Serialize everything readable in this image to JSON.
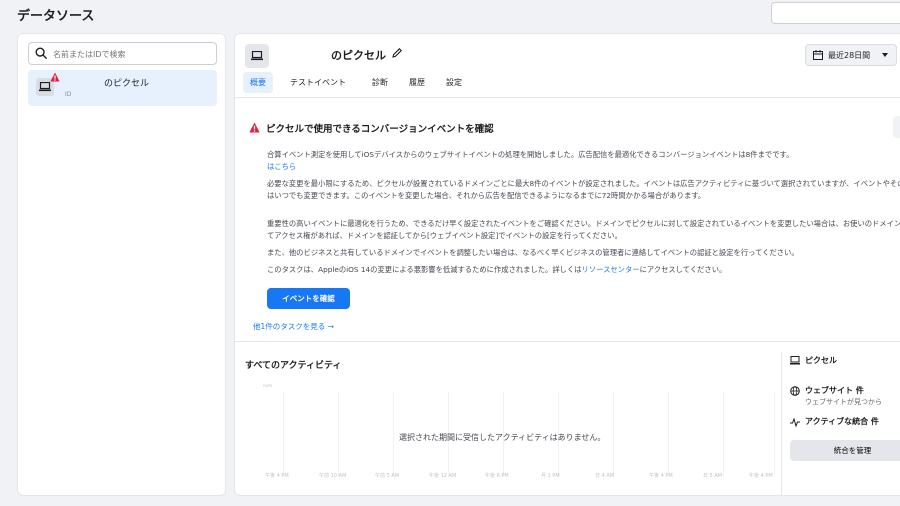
{
  "header": {
    "title": "データソース",
    "search_value": ""
  },
  "sidebar": {
    "search_placeholder": "名前またはIDで検索",
    "items": [
      {
        "name": "のピクセル",
        "id_label": "ID"
      }
    ]
  },
  "pixel": {
    "name": "のピクセル"
  },
  "date_range": {
    "label": "最近28日間"
  },
  "tabs": [
    {
      "label": "概要",
      "active": true
    },
    {
      "label": "テストイベント",
      "active": false
    },
    {
      "label": "診断",
      "active": false
    },
    {
      "label": "履歴",
      "active": false
    },
    {
      "label": "設定",
      "active": false
    }
  ],
  "alert": {
    "title": "ピクセルで使用できるコンバージョンイベントを確認",
    "p1": "合算イベント測定を使用してiOSデバイスからのウェブサイトイベントの処理を開始しました。広告配信を最適化できるコンバージョンイベントは8件までです。",
    "p1_link": "はこちら",
    "p2": "必要な変更を最小限にするため、ピクセルが設置されているドメインごとに最大8件のイベントが設定されました。イベントは広告アクティビティに基づいて選択されていますが、イベントやその優先度はいつでも変更できます。このイベントを変更した場合、それから広告を配信できるようになるまでに72時間かかる場合があります。",
    "p3": "重要性の高いイベントに最適化を行うため、できるだけ早く設定されたイベントをご確認ください。ドメインでピクセルに対して設定されているイベントを変更したい場合は、お使いのドメインに対してアクセス権があれば、ドメインを認証してから[ウェブイベント設定]でイベントの設定を行ってください。",
    "p4": "また、他のビジネスと共有しているドメインでイベントを調整したい場合は、なるべく早くビジネスの管理者に連絡してイベントの認証と設定を行ってください。",
    "p5_pre": "このタスクは、AppleのiOS 14の変更による悪影響を低減するために作成されました。詳しくは",
    "p5_link": "リソースセンター",
    "p5_post": "にアクセスしてください。",
    "button": "イベントを確認",
    "more_tasks": "他1件のタスクを見る →"
  },
  "activity": {
    "title": "すべてのアクティビティ",
    "empty_message": "選択された期間に受信したアクティビティはありません。",
    "y_label": "num",
    "x_labels": [
      "午後 4 PM",
      "午前 10 AM",
      "午前 5 AM",
      "午後 12 AM",
      "午後 6 PM",
      "月 1 PM",
      "日 4 AM",
      "午後 4 PM",
      "日 5 AM",
      "午後 4 PM"
    ]
  },
  "side_info": {
    "pixel_label": "ピクセル",
    "website_label": "ウェブサイト 件",
    "website_sub": "ウェブサイトが見つから",
    "integrations_label": "アクティブな統合 件",
    "manage_button": "統合を管理"
  }
}
